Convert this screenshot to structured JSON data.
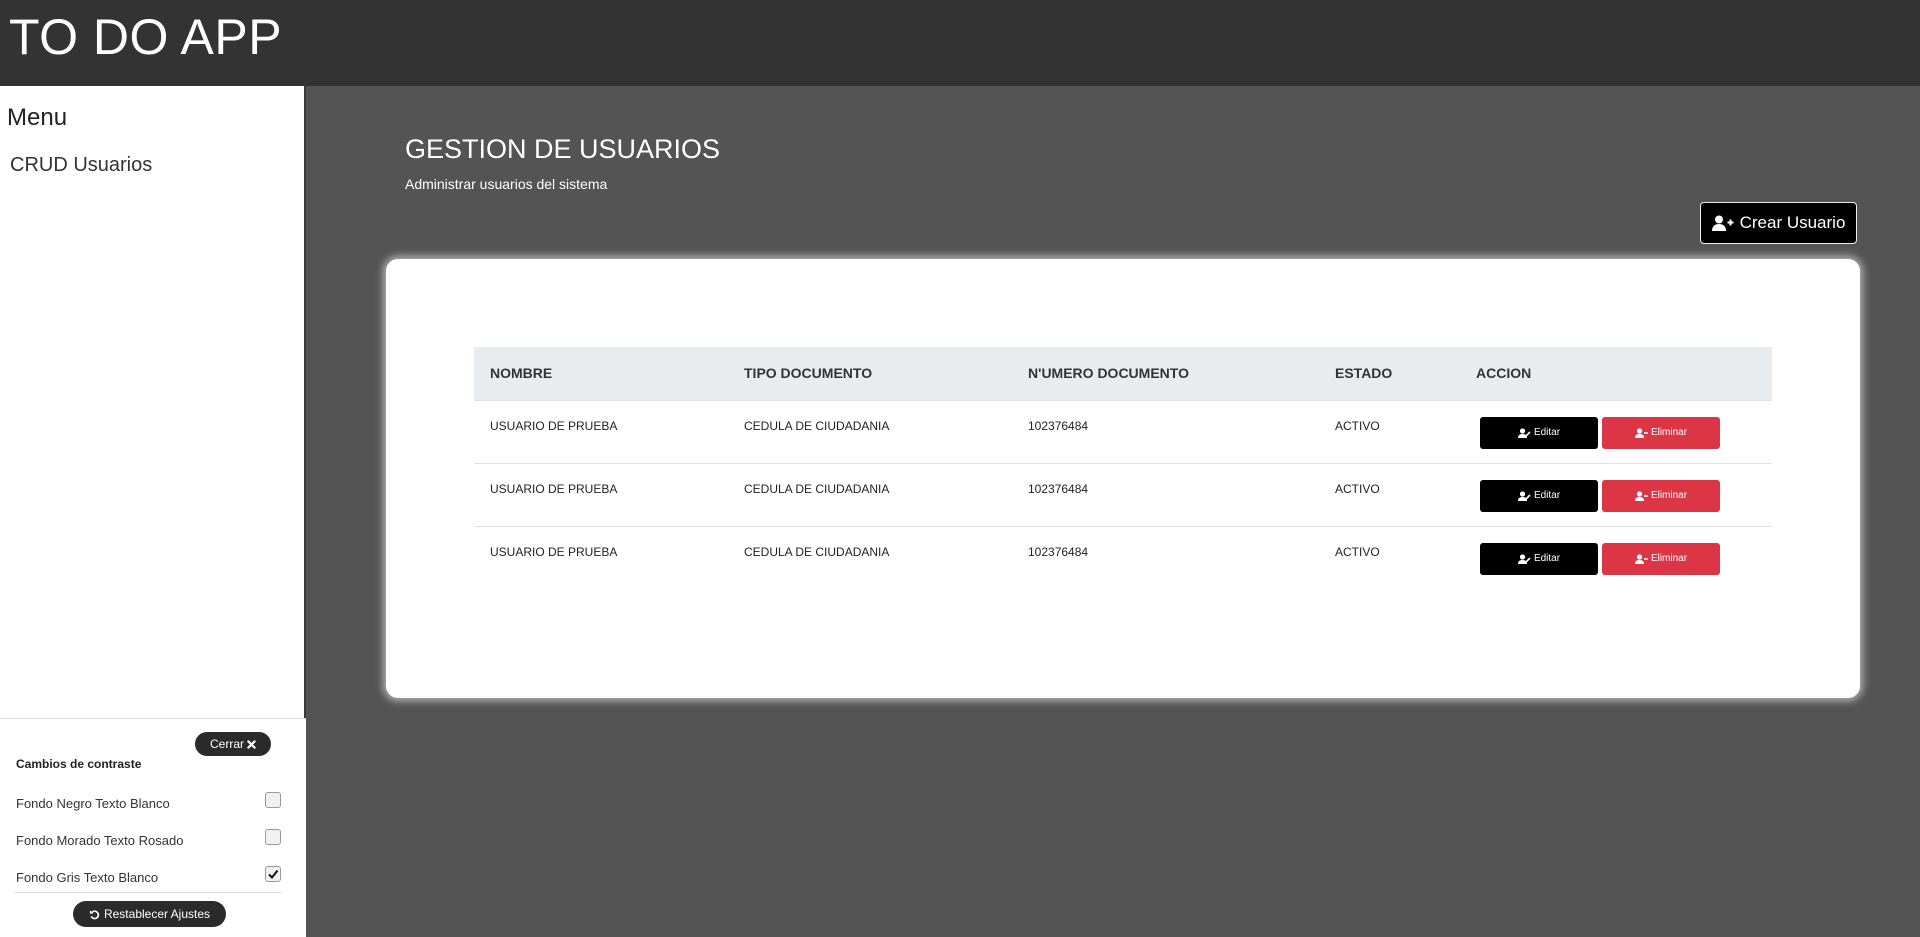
{
  "app": {
    "title": "TO DO APP"
  },
  "sidebar": {
    "menu_title": "Menu",
    "items": [
      {
        "label": "CRUD Usuarios"
      }
    ]
  },
  "contrast": {
    "close_label": "Cerrar",
    "title": "Cambios de contraste",
    "options": [
      {
        "label": "Fondo Negro Texto Blanco",
        "checked": false
      },
      {
        "label": "Fondo Morado Texto Rosado",
        "checked": false
      },
      {
        "label": "Fondo Gris Texto Blanco",
        "checked": true
      }
    ],
    "reset_label": "Restablecer Ajustes"
  },
  "main": {
    "title": "GESTION DE USUARIOS",
    "subtitle": "Administrar usuarios del sistema",
    "create_label": "Crear Usuario"
  },
  "table": {
    "headers": [
      "NOMBRE",
      "TIPO DOCUMENTO",
      "N'UMERO DOCUMENTO",
      "ESTADO",
      "ACCION"
    ],
    "edit_label": "Editar",
    "delete_label": "Eliminar",
    "rows": [
      {
        "nombre": "USUARIO DE PRUEBA",
        "tipo": "CEDULA DE CIUDADANIA",
        "numero": "102376484",
        "estado": "ACTIVO"
      },
      {
        "nombre": "USUARIO DE PRUEBA",
        "tipo": "CEDULA DE CIUDADANIA",
        "numero": "102376484",
        "estado": "ACTIVO"
      },
      {
        "nombre": "USUARIO DE PRUEBA",
        "tipo": "CEDULA DE CIUDADANIA",
        "numero": "102376484",
        "estado": "ACTIVO"
      }
    ]
  },
  "colors": {
    "topbar": "#333333",
    "background": "#545454",
    "danger": "#dc3545"
  }
}
